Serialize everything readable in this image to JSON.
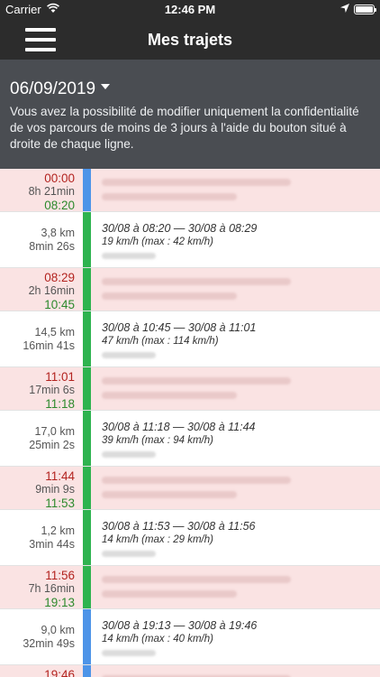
{
  "status_bar": {
    "carrier": "Carrier",
    "time": "12:46 PM"
  },
  "nav": {
    "title": "Mes trajets"
  },
  "header": {
    "date": "06/09/2019",
    "info": "Vous avez la possibilité de modifier uniquement la confidentialité de vos parcours de moins de 3 jours à l'aide du bouton situé à droite de chaque ligne."
  },
  "colors": {
    "nav_bg": "#2c2c2c",
    "header_bg": "#4a4d52",
    "stop_bg": "#fae3e3",
    "stop_time_red": "#b3231f",
    "stop_time_green": "#2d8a2d",
    "bar_blue": "#4d94e8",
    "bar_green": "#2eb34f"
  },
  "rows": [
    {
      "type": "stop",
      "start": "00:00",
      "duration": "8h 21min",
      "end": "08:20",
      "bar": "blue"
    },
    {
      "type": "trip",
      "distance": "3,8 km",
      "duration": "8min 26s",
      "range": "30/08 à 08:20 — 30/08 à 08:29",
      "speed": "19 km/h (max : 42 km/h)",
      "bar": "green"
    },
    {
      "type": "stop",
      "start": "08:29",
      "duration": "2h 16min",
      "end": "10:45",
      "bar": "green"
    },
    {
      "type": "trip",
      "distance": "14,5 km",
      "duration": "16min 41s",
      "range": "30/08 à 10:45 — 30/08 à 11:01",
      "speed": "47 km/h (max : 114 km/h)",
      "bar": "green"
    },
    {
      "type": "stop",
      "start": "11:01",
      "duration": "17min 6s",
      "end": "11:18",
      "bar": "green"
    },
    {
      "type": "trip",
      "distance": "17,0 km",
      "duration": "25min 2s",
      "range": "30/08 à 11:18 — 30/08 à 11:44",
      "speed": "39 km/h (max : 94 km/h)",
      "bar": "green"
    },
    {
      "type": "stop",
      "start": "11:44",
      "duration": "9min 9s",
      "end": "11:53",
      "bar": "green"
    },
    {
      "type": "trip",
      "distance": "1,2 km",
      "duration": "3min 44s",
      "range": "30/08 à 11:53 — 30/08 à 11:56",
      "speed": "14 km/h (max : 29 km/h)",
      "bar": "green"
    },
    {
      "type": "stop",
      "start": "11:56",
      "duration": "7h 16min",
      "end": "19:13",
      "bar": "green"
    },
    {
      "type": "trip",
      "distance": "9,0 km",
      "duration": "32min 49s",
      "range": "30/08 à 19:13 — 30/08 à 19:46",
      "speed": "14 km/h (max : 40 km/h)",
      "bar": "blue"
    },
    {
      "type": "stop",
      "start": "19:46",
      "duration": "",
      "end": "",
      "bar": "blue"
    }
  ]
}
